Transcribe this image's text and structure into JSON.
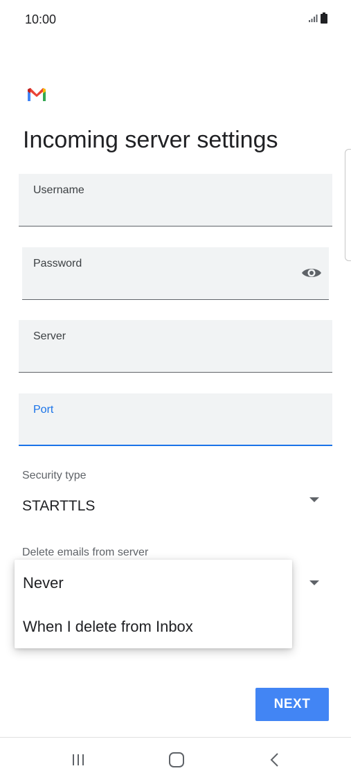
{
  "status_bar": {
    "time": "10:00",
    "icons": [
      "signal-icon",
      "battery-icon"
    ]
  },
  "app": {
    "logo": "gmail-logo"
  },
  "page": {
    "title": "Incoming server settings"
  },
  "fields": {
    "username": {
      "label": "Username",
      "value": ""
    },
    "password": {
      "label": "Password",
      "value": "",
      "toggle_icon": "eye-icon"
    },
    "server": {
      "label": "Server",
      "value": ""
    },
    "port": {
      "label": "Port",
      "value": "",
      "focused": true
    }
  },
  "security_type": {
    "label": "Security type",
    "value": "STARTTLS"
  },
  "delete_emails": {
    "label": "Delete emails from server",
    "options": [
      "Never",
      "When I delete from Inbox"
    ]
  },
  "actions": {
    "next_label": "NEXT"
  },
  "colors": {
    "accent": "#1a73e8",
    "button": "#4285f4",
    "field_bg": "#f1f3f4"
  },
  "nav_bar": {
    "icons": [
      "recents-icon",
      "home-icon",
      "back-icon"
    ]
  }
}
